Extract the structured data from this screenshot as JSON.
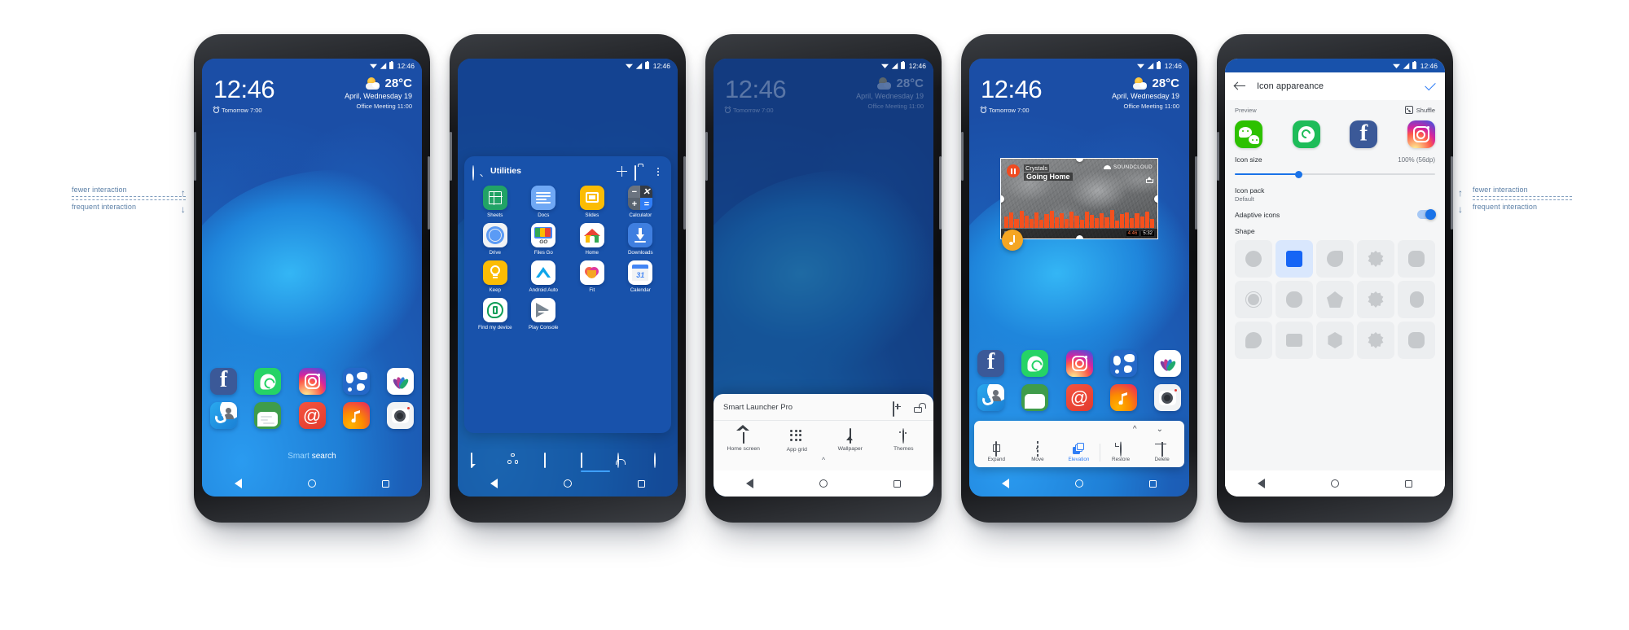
{
  "annotations": {
    "left": {
      "top_label": "fewer interaction",
      "bottom_label": "frequent interaction"
    },
    "right": {
      "top_label": "fewer interaction",
      "bottom_label": "frequent interaction"
    }
  },
  "status_bar": {
    "time": "12:46",
    "wifi_icon": "wifi-icon",
    "signal_icon": "signal-icon",
    "battery_icon": "battery-icon"
  },
  "phone1": {
    "name": "home-screen",
    "clock": {
      "time": "12:46",
      "alarm": "Tomorrow 7:00",
      "alarm_icon": "alarm-icon"
    },
    "weather": {
      "temp": "28°C",
      "date": "April, Wednesday 19",
      "event": "Office Meeting 11:00",
      "icon": "partly-cloudy-icon"
    },
    "dock_rows": [
      [
        {
          "label": "",
          "icon": "facebook-icon"
        },
        {
          "label": "",
          "icon": "whatsapp-icon"
        },
        {
          "label": "",
          "icon": "instagram-icon"
        },
        {
          "label": "",
          "icon": "maps-icon"
        },
        {
          "label": "",
          "icon": "lotus-icon"
        }
      ],
      [
        {
          "label": "",
          "icon": "phone-contacts-icon"
        },
        {
          "label": "",
          "icon": "messages-icon"
        },
        {
          "label": "",
          "icon": "email-icon"
        },
        {
          "label": "",
          "icon": "music-icon"
        },
        {
          "label": "",
          "icon": "camera-icon"
        }
      ]
    ],
    "search": {
      "accent_word": "Smart",
      "word": " search"
    },
    "nav": {
      "back": "back-icon",
      "home": "home-icon",
      "recents": "recents-icon"
    }
  },
  "phone2": {
    "name": "app-drawer",
    "drawer": {
      "title": "Utilities",
      "search_icon": "search-icon",
      "add_icon": "plus-icon",
      "work_icon": "briefcase-icon",
      "more_icon": "overflow-menu-icon",
      "apps": [
        {
          "label": "Sheets",
          "icon": "google-sheets-icon"
        },
        {
          "label": "Docs",
          "icon": "google-docs-icon"
        },
        {
          "label": "Slides",
          "icon": "google-slides-icon"
        },
        {
          "label": "Calculator",
          "icon": "calculator-icon"
        },
        {
          "label": "Drive",
          "icon": "google-drive-icon"
        },
        {
          "label": "Files Go",
          "icon": "files-go-icon"
        },
        {
          "label": "Home",
          "icon": "google-home-icon"
        },
        {
          "label": "Downloads",
          "icon": "downloads-icon"
        },
        {
          "label": "Keep",
          "icon": "google-keep-icon"
        },
        {
          "label": "Android Auto",
          "icon": "android-auto-icon"
        },
        {
          "label": "Fit",
          "icon": "google-fit-icon"
        },
        {
          "label": "Calendar",
          "icon": "calendar-icon",
          "day": "31"
        },
        {
          "label": "Find my device",
          "icon": "find-my-device-icon"
        },
        {
          "label": "Play Console",
          "icon": "play-console-icon"
        }
      ]
    },
    "category_tabs": [
      {
        "icon": "communication-tab-icon"
      },
      {
        "icon": "social-tab-icon"
      },
      {
        "icon": "media-tab-icon"
      },
      {
        "icon": "games-tab-icon"
      },
      {
        "icon": "personal-tab-icon"
      },
      {
        "icon": "settings-tab-icon"
      }
    ]
  },
  "phone3": {
    "name": "launcher-settings-sheet",
    "sheet": {
      "title": "Smart Launcher Pro",
      "add_icon": "add-box-icon",
      "lock_icon": "unlock-icon",
      "expand_icon": "chevron-up-icon",
      "items": [
        {
          "label": "Home screen",
          "icon": "home-screen-icon"
        },
        {
          "label": "App grid",
          "icon": "app-grid-icon"
        },
        {
          "label": "Wallpaper",
          "icon": "wallpaper-icon"
        },
        {
          "label": "Themes",
          "icon": "themes-palette-icon"
        }
      ]
    }
  },
  "phone4": {
    "name": "widget-edit-screen",
    "clock": {
      "time": "12:46",
      "alarm": "Tomorrow 7:00"
    },
    "weather": {
      "temp": "28°C",
      "date": "April, Wednesday 19",
      "event": "Office Meeting 11:00"
    },
    "widget": {
      "artist": "Crystals",
      "track": "Going Home",
      "brand": "SOUNDCLOUD",
      "elapsed": "4:46",
      "duration": "5:32",
      "pause_icon": "pause-icon",
      "share_icon": "share-icon"
    },
    "fab": {
      "icon": "music-note-icon"
    },
    "edit_toolbar": {
      "up_icon": "chevron-up-icon",
      "down_icon": "chevron-down-icon",
      "items": [
        {
          "label": "Expand",
          "icon": "expand-icon",
          "active": false
        },
        {
          "label": "Move",
          "icon": "move-icon",
          "active": false
        },
        {
          "label": "Elevation",
          "icon": "elevation-icon",
          "active": true
        },
        {
          "label": "Restore",
          "icon": "restore-icon",
          "active": false
        },
        {
          "label": "Delete",
          "icon": "delete-icon",
          "active": false
        }
      ]
    }
  },
  "phone5": {
    "name": "icon-appearance-settings",
    "appbar": {
      "title": "Icon appareance",
      "back_icon": "arrow-back-icon",
      "confirm_icon": "check-icon"
    },
    "preview": {
      "label": "Preview",
      "shuffle_label": "Shuffle",
      "shuffle_icon": "shuffle-dice-icon",
      "icons": [
        {
          "icon": "wechat-icon"
        },
        {
          "icon": "whatsapp-icon"
        },
        {
          "icon": "facebook-icon"
        },
        {
          "icon": "instagram-icon"
        }
      ]
    },
    "icon_size": {
      "label": "Icon size",
      "value": "100% (56dp)",
      "slider_percent": 32
    },
    "icon_pack": {
      "label": "Icon pack",
      "value": "Default"
    },
    "adaptive_icons": {
      "label": "Adaptive icons",
      "enabled": true
    },
    "shape": {
      "label": "Shape",
      "options": [
        {
          "name": "circle",
          "selected": false
        },
        {
          "name": "square",
          "selected": true
        },
        {
          "name": "teardrop",
          "selected": false
        },
        {
          "name": "flower",
          "selected": false
        },
        {
          "name": "rounded-rect",
          "selected": false
        },
        {
          "name": "ring",
          "selected": false
        },
        {
          "name": "squircle",
          "selected": false
        },
        {
          "name": "pentagon",
          "selected": false
        },
        {
          "name": "star-burst",
          "selected": false
        },
        {
          "name": "tall-rounded",
          "selected": false
        },
        {
          "name": "circle-2",
          "selected": false
        },
        {
          "name": "wide-rect",
          "selected": false
        },
        {
          "name": "hexagon",
          "selected": false
        },
        {
          "name": "cloud",
          "selected": false
        },
        {
          "name": "soft-square",
          "selected": false
        }
      ]
    }
  },
  "colors": {
    "accent": "#1a73e8",
    "wallpaper_blue": "#1b56b0",
    "drawer_blue": "#1852ab",
    "annotation": "#5b7fa6"
  }
}
